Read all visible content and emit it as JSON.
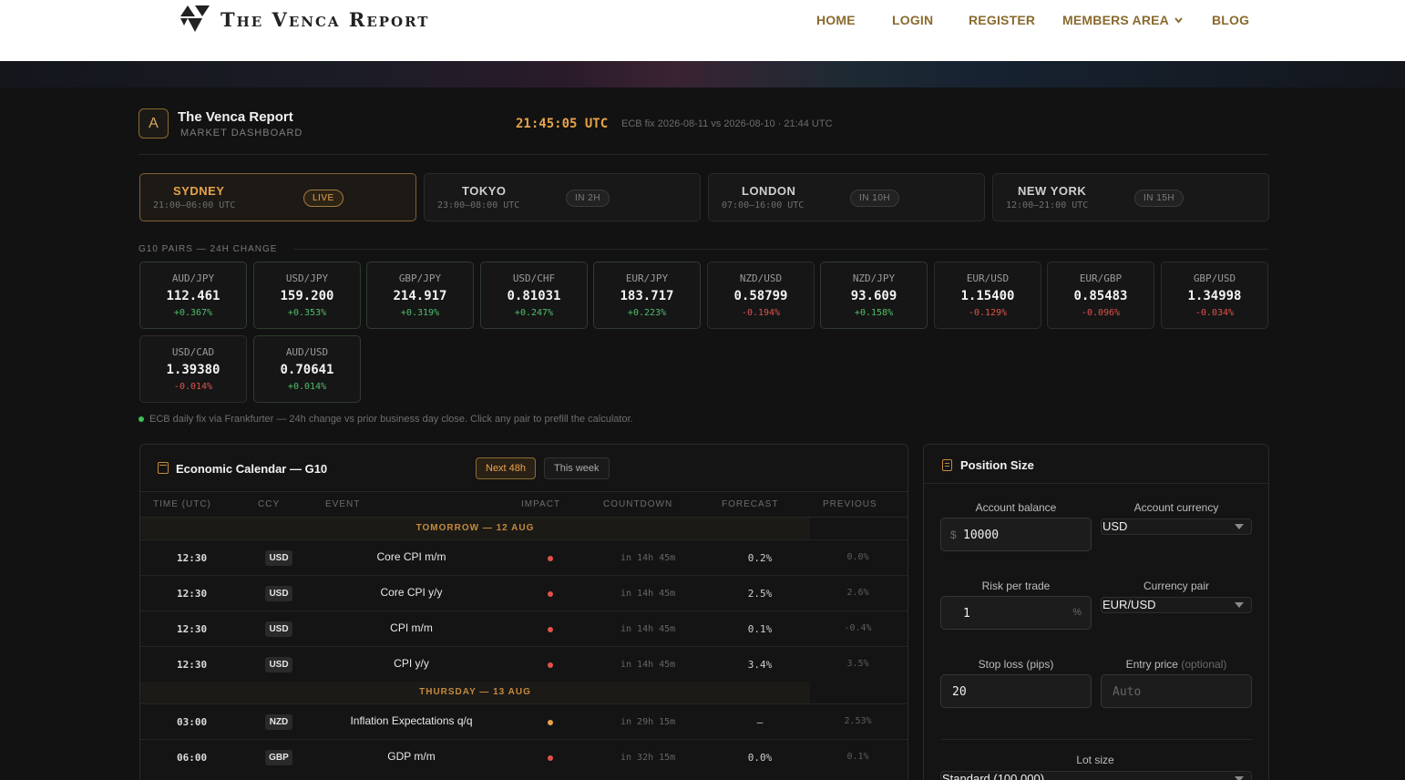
{
  "site": {
    "logo_text": "The Venca Report"
  },
  "nav": {
    "items": [
      "HOME",
      "LOGIN",
      "REGISTER",
      "MEMBERS AREA",
      "BLOG"
    ]
  },
  "dashboard": {
    "icon_letter": "A",
    "title": "The Venca Report",
    "subtitle": "MARKET DASHBOARD",
    "clock": "21:45:05 UTC",
    "fix_note": "ECB fix 2026-08-11 vs 2026-08-10 · 21:44 UTC"
  },
  "sessions": [
    {
      "name": "SYDNEY",
      "hours": "21:00–06:00 UTC",
      "status": "LIVE",
      "active": true
    },
    {
      "name": "TOKYO",
      "hours": "23:00–08:00 UTC",
      "status": "IN 2H",
      "active": false
    },
    {
      "name": "LONDON",
      "hours": "07:00–16:00 UTC",
      "status": "IN 10H",
      "active": false
    },
    {
      "name": "NEW YORK",
      "hours": "12:00–21:00 UTC",
      "status": "IN 15H",
      "active": false
    }
  ],
  "pairs_section": {
    "label": "G10 PAIRS — 24H CHANGE",
    "pairs": [
      {
        "symbol": "AUD/JPY",
        "price": "112.461",
        "change": "+0.367%",
        "dir": "up"
      },
      {
        "symbol": "USD/JPY",
        "price": "159.200",
        "change": "+0.353%",
        "dir": "up"
      },
      {
        "symbol": "GBP/JPY",
        "price": "214.917",
        "change": "+0.319%",
        "dir": "up"
      },
      {
        "symbol": "USD/CHF",
        "price": "0.81031",
        "change": "+0.247%",
        "dir": "up"
      },
      {
        "symbol": "EUR/JPY",
        "price": "183.717",
        "change": "+0.223%",
        "dir": "up"
      },
      {
        "symbol": "NZD/USD",
        "price": "0.58799",
        "change": "-0.194%",
        "dir": "down"
      },
      {
        "symbol": "NZD/JPY",
        "price": "93.609",
        "change": "+0.158%",
        "dir": "up"
      },
      {
        "symbol": "EUR/USD",
        "price": "1.15400",
        "change": "-0.129%",
        "dir": "down"
      },
      {
        "symbol": "EUR/GBP",
        "price": "0.85483",
        "change": "-0.096%",
        "dir": "down"
      },
      {
        "symbol": "GBP/USD",
        "price": "1.34998",
        "change": "-0.034%",
        "dir": "down"
      },
      {
        "symbol": "USD/CAD",
        "price": "1.39380",
        "change": "-0.014%",
        "dir": "down"
      },
      {
        "symbol": "AUD/USD",
        "price": "0.70641",
        "change": "+0.014%",
        "dir": "up"
      }
    ],
    "note": "ECB daily fix via Frankfurter — 24h change vs prior business day close. Click any pair to prefill the calculator."
  },
  "calendar": {
    "title": "Economic Calendar — G10",
    "tabs": [
      "Next 48h",
      "This week"
    ],
    "columns": [
      "TIME (UTC)",
      "CCY",
      "EVENT",
      "IMPACT",
      "COUNTDOWN",
      "FORECAST",
      "PREVIOUS"
    ],
    "groups": [
      {
        "day": "TOMORROW — 12 AUG",
        "events": [
          {
            "time": "12:30",
            "ccy": "USD",
            "event": "Core CPI m/m",
            "impact": "high",
            "countdown": "in 14h 45m",
            "forecast": "0.2%",
            "previous": "0.0%"
          },
          {
            "time": "12:30",
            "ccy": "USD",
            "event": "Core CPI y/y",
            "impact": "high",
            "countdown": "in 14h 45m",
            "forecast": "2.5%",
            "previous": "2.6%"
          },
          {
            "time": "12:30",
            "ccy": "USD",
            "event": "CPI m/m",
            "impact": "high",
            "countdown": "in 14h 45m",
            "forecast": "0.1%",
            "previous": "-0.4%"
          },
          {
            "time": "12:30",
            "ccy": "USD",
            "event": "CPI y/y",
            "impact": "high",
            "countdown": "in 14h 45m",
            "forecast": "3.4%",
            "previous": "3.5%"
          }
        ]
      },
      {
        "day": "THURSDAY — 13 AUG",
        "events": [
          {
            "time": "03:00",
            "ccy": "NZD",
            "event": "Inflation Expectations q/q",
            "impact": "medium",
            "countdown": "in 29h 15m",
            "forecast": "–",
            "previous": "2.53%"
          },
          {
            "time": "06:00",
            "ccy": "GBP",
            "event": "GDP m/m",
            "impact": "high",
            "countdown": "in 32h 15m",
            "forecast": "0.0%",
            "previous": "0.1%"
          }
        ]
      }
    ]
  },
  "position": {
    "title": "Position Size",
    "balance_label": "Account balance",
    "balance_prefix": "$",
    "balance_value": "10000",
    "currency_label": "Account currency",
    "currency_value": "USD",
    "risk_label": "Risk per trade",
    "risk_value": "1",
    "risk_suffix": "%",
    "pair_label": "Currency pair",
    "pair_value": "EUR/USD",
    "stop_label": "Stop loss (pips)",
    "stop_value": "20",
    "entry_label": "Entry price",
    "entry_optional": "(optional)",
    "entry_placeholder": "Auto",
    "lot_label": "Lot size",
    "lot_value": "Standard (100,000)"
  },
  "colors": {
    "accent": "#e8a34a",
    "positive": "#4fbf6a",
    "negative": "#e0524a",
    "high_impact": "#e0524a",
    "medium_impact": "#e8a34a"
  }
}
